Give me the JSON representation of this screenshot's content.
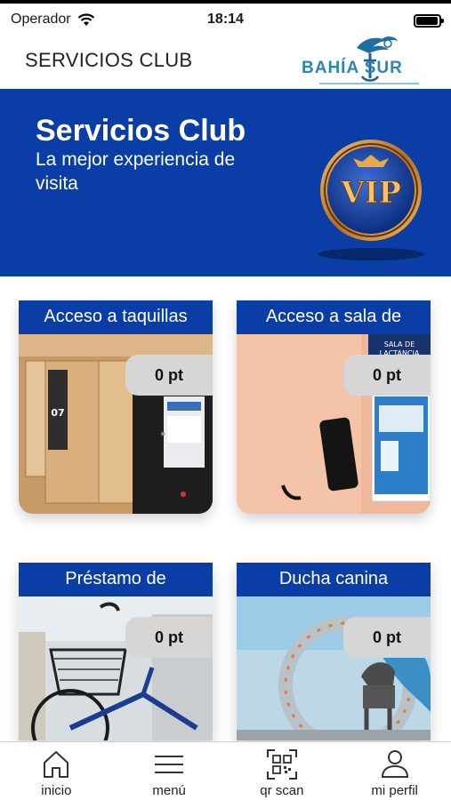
{
  "status_bar": {
    "carrier": "Operador",
    "time": "18:14",
    "battery_level": 0.95
  },
  "header": {
    "title": "SERVICIOS CLUB",
    "logo_text": "BAHÍA SUR"
  },
  "banner": {
    "title": "Servicios Club",
    "subtitle": "La mejor experiencia de visita",
    "badge_text": "VIP"
  },
  "services": [
    {
      "title": "Acceso a taquillas",
      "points": "0 pt",
      "icon": "locker-photo"
    },
    {
      "title": "Acceso a sala de",
      "points": "0 pt",
      "icon": "nursing-room-photo"
    },
    {
      "title": "Préstamo de",
      "points": "0 pt",
      "icon": "bicycle-photo"
    },
    {
      "title": "Ducha canina",
      "points": "0 pt",
      "icon": "dog-shower-photo"
    }
  ],
  "tab_bar": {
    "items": [
      {
        "label": "inicio",
        "icon": "home-icon"
      },
      {
        "label": "menú",
        "icon": "menu-icon"
      },
      {
        "label": "qr scan",
        "icon": "qr-scan-icon"
      },
      {
        "label": "mi perfil",
        "icon": "profile-icon"
      }
    ]
  },
  "colors": {
    "brand_blue": "#0a3ea6",
    "logo_blue": "#2a86b8",
    "badge_gold": "#c8882a"
  }
}
